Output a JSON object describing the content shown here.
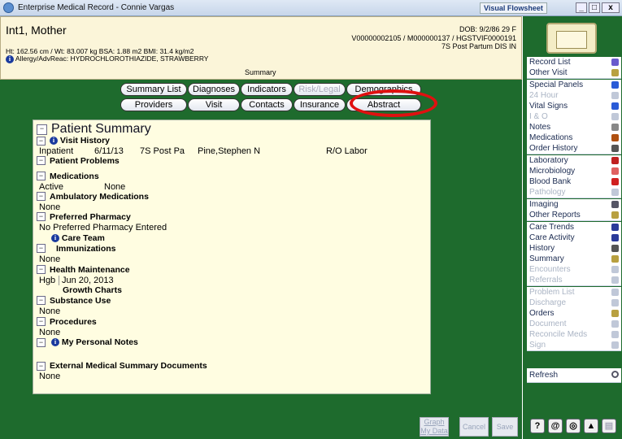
{
  "window": {
    "title": "Enterprise Medical Record - Connie Vargas",
    "visual_flowsheet": "Visual Flowsheet",
    "min": "_",
    "max": "□",
    "close": "x"
  },
  "patient": {
    "name": "Int1, Mother",
    "dob": "DOB: 9/2/86 29 F",
    "ids": "V00000002105 / M000000137 / HGSTVIF0000191",
    "location": "7S Post Partum  DIS IN",
    "vitals": "Ht: 162.56 cm / Wt: 83.007 kg   BSA: 1.88 m2  BMI: 31.4 kg/m2",
    "allergy": "Allergy/AdvReac: HYDROCHLOROTHIAZIDE, STRAWBERRY",
    "view_label": "Summary"
  },
  "tabs_row1": [
    "Summary List",
    "Diagnoses",
    "Indicators",
    "Risk/Legal",
    "Demographics"
  ],
  "tabs_row2": [
    "Providers",
    "Visit",
    "Contacts",
    "Insurance",
    "Abstract"
  ],
  "summary": {
    "title": "Patient Summary",
    "visit_history": "Visit History",
    "visit_row": {
      "type": "Inpatient",
      "date": "6/11/13",
      "location": "7S Post Pa",
      "provider": "Pine,Stephen N",
      "reason": "R/O Labor"
    },
    "patient_problems": "Patient Problems",
    "medications": "Medications",
    "med_status": "Active",
    "med_value": "None",
    "ambulatory_meds": "Ambulatory Medications",
    "ambulatory_value": "None",
    "preferred_pharmacy": "Preferred Pharmacy",
    "pharmacy_value": "No Preferred Pharmacy Entered",
    "care_team": "Care Team",
    "immunizations": "Immunizations",
    "immunizations_value": "None",
    "health_maintenance": "Health Maintenance",
    "hm_test": "Hgb",
    "hm_date": "Jun 20, 2013",
    "growth_charts": "Growth Charts",
    "substance_use": "Substance Use",
    "substance_value": "None",
    "procedures": "Procedures",
    "procedures_value": "None",
    "personal_notes": "My Personal Notes",
    "external_docs": "External Medical Summary Documents",
    "external_value": "None"
  },
  "sidebar": [
    {
      "label": "Record List",
      "enabled": true,
      "icon": "help-icon",
      "color": "#6a5acd"
    },
    {
      "label": "Other Visit",
      "enabled": true,
      "icon": "visit-icon",
      "color": "#b8a040"
    },
    {
      "label": "Special Panels",
      "enabled": true,
      "icon": "arrow-icon",
      "color": "#2a5bd7"
    },
    {
      "label": "24 Hour",
      "enabled": false,
      "icon": "clock-icon",
      "color": "#c0c8d8"
    },
    {
      "label": "Vital Signs",
      "enabled": true,
      "icon": "arrow-icon",
      "color": "#2a5bd7"
    },
    {
      "label": "I & O",
      "enabled": false,
      "icon": "drop-icon",
      "color": "#c0c8d8"
    },
    {
      "label": "Notes",
      "enabled": true,
      "icon": "note-icon",
      "color": "#888"
    },
    {
      "label": "Medications",
      "enabled": true,
      "icon": "pill-icon",
      "color": "#b05010"
    },
    {
      "label": "Order History",
      "enabled": true,
      "icon": "search-icon",
      "color": "#555"
    },
    {
      "label": "Laboratory",
      "enabled": true,
      "icon": "pen-icon",
      "color": "#c02020"
    },
    {
      "label": "Microbiology",
      "enabled": true,
      "icon": "circle-icon",
      "color": "#e06060"
    },
    {
      "label": "Blood Bank",
      "enabled": true,
      "icon": "drop-icon",
      "color": "#d02020"
    },
    {
      "label": "Pathology",
      "enabled": false,
      "icon": "flask-icon",
      "color": "#c0c8d8"
    },
    {
      "label": "Imaging",
      "enabled": true,
      "icon": "image-icon",
      "color": "#556"
    },
    {
      "label": "Other Reports",
      "enabled": true,
      "icon": "report-icon",
      "color": "#b8a040"
    },
    {
      "label": "Care Trends",
      "enabled": true,
      "icon": "team-icon",
      "color": "#2a3a9a"
    },
    {
      "label": "Care Activity",
      "enabled": true,
      "icon": "team-icon",
      "color": "#2a3a9a"
    },
    {
      "label": "History",
      "enabled": true,
      "icon": "search-icon",
      "color": "#555"
    },
    {
      "label": "Summary",
      "enabled": true,
      "icon": "doc-icon",
      "color": "#b8a040"
    },
    {
      "label": "Encounters",
      "enabled": false,
      "icon": "doc-icon",
      "color": "#c0c8d8"
    },
    {
      "label": "Referrals",
      "enabled": false,
      "icon": "doc-icon",
      "color": "#c0c8d8"
    },
    {
      "label": "Problem List",
      "enabled": false,
      "icon": "list-icon",
      "color": "#c0c8d8"
    },
    {
      "label": "Discharge",
      "enabled": false,
      "icon": "exit-icon",
      "color": "#c0c8d8"
    },
    {
      "label": "Orders",
      "enabled": true,
      "icon": "order-icon",
      "color": "#b8a040"
    },
    {
      "label": "Document",
      "enabled": false,
      "icon": "doc-icon",
      "color": "#c0c8d8"
    },
    {
      "label": "Reconcile Meds",
      "enabled": false,
      "icon": "doc-icon",
      "color": "#c0c8d8"
    },
    {
      "label": "Sign",
      "enabled": false,
      "icon": "sign-icon",
      "color": "#c0c8d8"
    }
  ],
  "refresh": "Refresh",
  "footer": {
    "graph": "Graph",
    "graph_sub": "My Data",
    "cancel": "Cancel",
    "save": "Save"
  }
}
